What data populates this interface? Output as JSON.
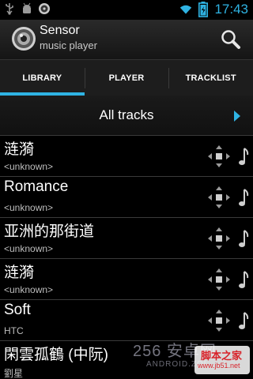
{
  "status_bar": {
    "time": "17:43",
    "icons": [
      "usb-icon",
      "android-debug-icon",
      "media-icon",
      "wifi-icon",
      "battery-charging-icon"
    ]
  },
  "action_bar": {
    "title": "Sensor",
    "subtitle": "music player",
    "search_icon": "search-icon"
  },
  "tabs": [
    {
      "label": "LIBRARY",
      "active": true
    },
    {
      "label": "PLAYER",
      "active": false
    },
    {
      "label": "TRACKLIST",
      "active": false
    }
  ],
  "all_tracks": {
    "label": "All tracks"
  },
  "tracks": [
    {
      "title": "涟漪",
      "artist": "<unknown>"
    },
    {
      "title": "Romance",
      "artist": "<unknown>"
    },
    {
      "title": "亚洲的那街道",
      "artist": "<unknown>"
    },
    {
      "title": "涟漪",
      "artist": "<unknown>"
    },
    {
      "title": "Soft",
      "artist": "HTC"
    },
    {
      "title": "閑雲孤鶴 (中阮)",
      "artist": "劉星"
    }
  ],
  "watermark": {
    "line1": "256 安卓网",
    "line2": "ANDROID.ZOL",
    "badge_top": "脚本之家",
    "badge_bottom": "www.jb51.net"
  },
  "colors": {
    "accent": "#2fb3e3"
  }
}
